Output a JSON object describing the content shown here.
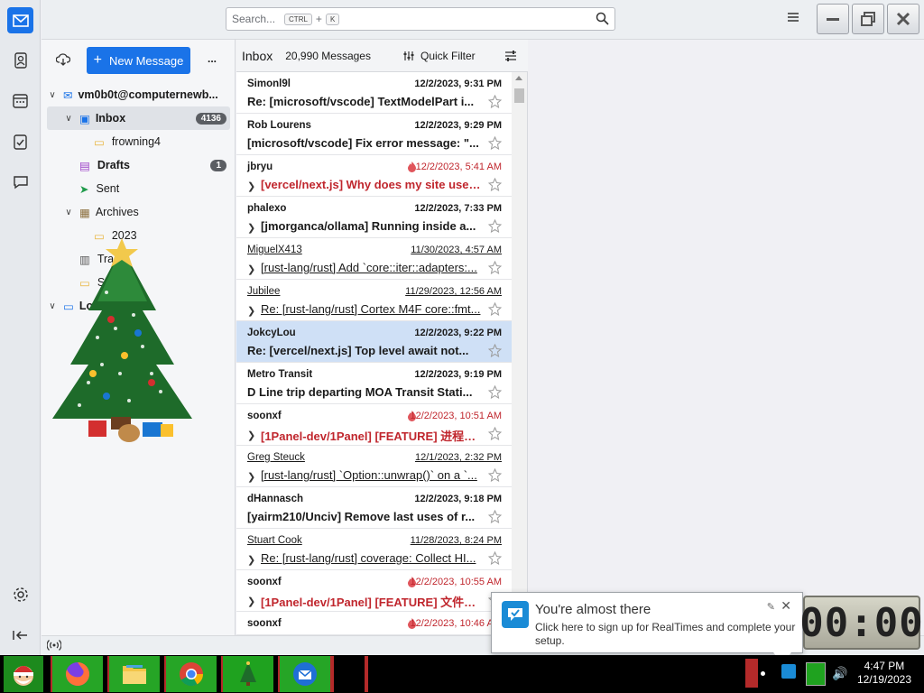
{
  "search": {
    "placeholder": "Search...",
    "shortcut_ctrl": "CTRL",
    "shortcut_plus": "+",
    "shortcut_key": "K"
  },
  "toolbar": {
    "new_message": "New Message",
    "more": "..."
  },
  "folders": {
    "account": "vm0b0t@computernewb...",
    "inbox": {
      "label": "Inbox",
      "count": "4136"
    },
    "frowning": "frowning4",
    "drafts": {
      "label": "Drafts",
      "count": "1"
    },
    "sent": "Sent",
    "archives": "Archives",
    "archive_year": "2023",
    "trash": "Trash",
    "spam": "Spa",
    "local": "Loc"
  },
  "list": {
    "title": "Inbox",
    "count": "20,990 Messages",
    "quick_filter": "Quick Filter",
    "messages": [
      {
        "sender": "Simonl9l",
        "date": "12/2/2023, 9:31 PM",
        "subject": "Re: [microsoft/vscode] TextModelPart i..."
      },
      {
        "sender": "Rob Lourens",
        "date": "12/2/2023, 9:29 PM",
        "subject": "[microsoft/vscode] Fix error message: \"..."
      },
      {
        "sender": "jbryu",
        "date": "12/2/2023, 5:41 AM",
        "subject": "[vercel/next.js] Why does my site use SS..."
      },
      {
        "sender": "phalexo",
        "date": "12/2/2023, 7:33 PM",
        "subject": "[jmorganca/ollama] Running inside a..."
      },
      {
        "sender": "MiguelX413",
        "date": "11/30/2023, 4:57 AM",
        "subject": "[rust-lang/rust] Add `core::iter::adapters:..."
      },
      {
        "sender": "Jubilee",
        "date": "11/29/2023, 12:56 AM",
        "subject": "Re: [rust-lang/rust] Cortex M4F core::fmt..."
      },
      {
        "sender": "JokcyLou",
        "date": "12/2/2023, 9:22 PM",
        "subject": "Re: [vercel/next.js] Top level await not..."
      },
      {
        "sender": "Metro Transit",
        "date": "12/2/2023, 9:19 PM",
        "subject": "D Line trip departing MOA Transit Stati..."
      },
      {
        "sender": "soonxf",
        "date": "12/2/2023, 10:51 AM",
        "subject": "[1Panel-dev/1Panel] [FEATURE] 进程守护 ..."
      },
      {
        "sender": "Greg Steuck",
        "date": "12/1/2023, 2:32 PM",
        "subject": "[rust-lang/rust] `Option::unwrap()` on a `..."
      },
      {
        "sender": "dHannasch",
        "date": "12/2/2023, 9:18 PM",
        "subject": "[yairm210/Unciv] Remove last uses of r..."
      },
      {
        "sender": "Stuart Cook",
        "date": "11/28/2023, 8:24 PM",
        "subject": "Re: [rust-lang/rust] coverage: Collect HI..."
      },
      {
        "sender": "soonxf",
        "date": "12/2/2023, 10:55 AM",
        "subject": "[1Panel-dev/1Panel] [FEATURE] 文件管理 ..."
      },
      {
        "sender": "soonxf",
        "date": "12/2/2023, 10:46 AM",
        "subject": ""
      }
    ]
  },
  "notification": {
    "title": "You're almost there",
    "body": "Click here to sign up for RealTimes and complete your setup."
  },
  "timer": "00:00",
  "clock": {
    "time": "4:47 PM",
    "date": "12/19/2023"
  },
  "colors": {
    "accent": "#1a73e8",
    "hot": "#c0262d",
    "selected_row": "#cfe0f6",
    "taskbar_green": "#26a526"
  }
}
